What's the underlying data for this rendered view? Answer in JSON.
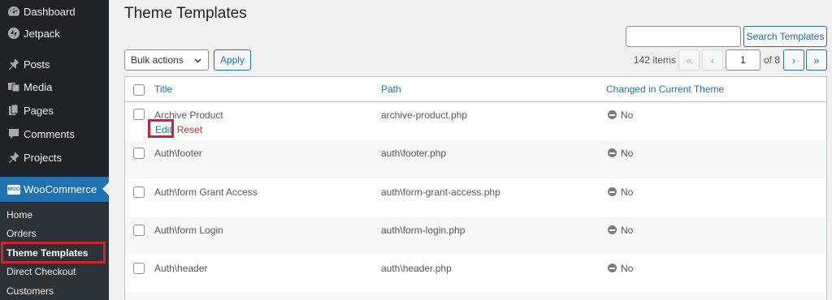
{
  "sidebar": {
    "items": [
      {
        "label": "Dashboard",
        "icon": "dashboard-icon"
      },
      {
        "label": "Jetpack",
        "icon": "jetpack-icon"
      },
      {
        "label": "Posts",
        "icon": "pin-icon"
      },
      {
        "label": "Media",
        "icon": "media-icon"
      },
      {
        "label": "Pages",
        "icon": "pages-icon"
      },
      {
        "label": "Comments",
        "icon": "comments-icon"
      },
      {
        "label": "Projects",
        "icon": "pin-icon"
      },
      {
        "label": "WooCommerce",
        "icon": "woocommerce-icon",
        "badge": "WOO"
      }
    ],
    "submenu": [
      "Home",
      "Orders",
      "Theme Templates",
      "Direct Checkout",
      "Customers"
    ]
  },
  "page": {
    "title": "Theme Templates"
  },
  "search": {
    "button_label": "Search Templates",
    "value": ""
  },
  "bulk": {
    "selected": "Bulk actions",
    "apply_label": "Apply"
  },
  "pagination": {
    "items": "142 items",
    "first": "«",
    "prev": "‹",
    "current": "1",
    "of_pages": "of 8",
    "next": "›",
    "last": "»"
  },
  "table": {
    "headers": {
      "title": "Title",
      "path": "Path",
      "changed": "Changed in Current Theme"
    },
    "rows": [
      {
        "title": "Archive Product",
        "path": "archive-product.php",
        "changed": "No",
        "actions": {
          "edit": "Edit",
          "reset": "Reset"
        }
      },
      {
        "title": "Auth\\footer",
        "path": "auth\\footer.php",
        "changed": "No"
      },
      {
        "title": "Auth\\form Grant Access",
        "path": "auth\\form-grant-access.php",
        "changed": "No"
      },
      {
        "title": "Auth\\form Login",
        "path": "auth\\form-login.php",
        "changed": "No"
      },
      {
        "title": "Auth\\header",
        "path": "auth\\header.php",
        "changed": "No"
      }
    ]
  },
  "colors": {
    "sidebar": "#1d2327",
    "active": "#2271b1",
    "highlight": "#d0222f",
    "link": "#2271b1",
    "danger": "#b32d2e"
  }
}
